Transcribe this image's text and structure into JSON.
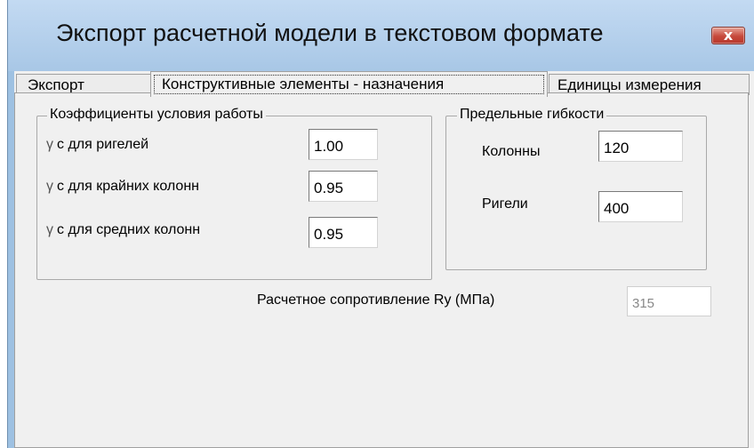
{
  "window": {
    "title": "Экспорт расчетной модели в текстовом формате",
    "close_label": "x"
  },
  "tabs": [
    {
      "label": "Экспорт"
    },
    {
      "label": "Конструктивные элементы - назначения"
    },
    {
      "label": "Единицы измерения"
    }
  ],
  "work_coeffs": {
    "title": "Коэффициенты условия работы",
    "gamma_symbol": "γ",
    "rows": [
      {
        "label": "с  для ригелей",
        "value": "1.00"
      },
      {
        "label": "с  для крайних колонн",
        "value": "0.95"
      },
      {
        "label": "с  для средних колонн",
        "value": "0.95"
      }
    ]
  },
  "slenderness": {
    "title": "Предельные гибкости",
    "columns_label": "Колонны",
    "columns_value": "120",
    "beams_label": "Ригели",
    "beams_value": "400"
  },
  "resistance": {
    "label": "Расчетное сопротивление Ry (МПа)",
    "value": "315"
  },
  "colors": {
    "title_bar": "#a8c7e6",
    "close_button": "#c6483b",
    "panel": "#f0f0f0"
  }
}
